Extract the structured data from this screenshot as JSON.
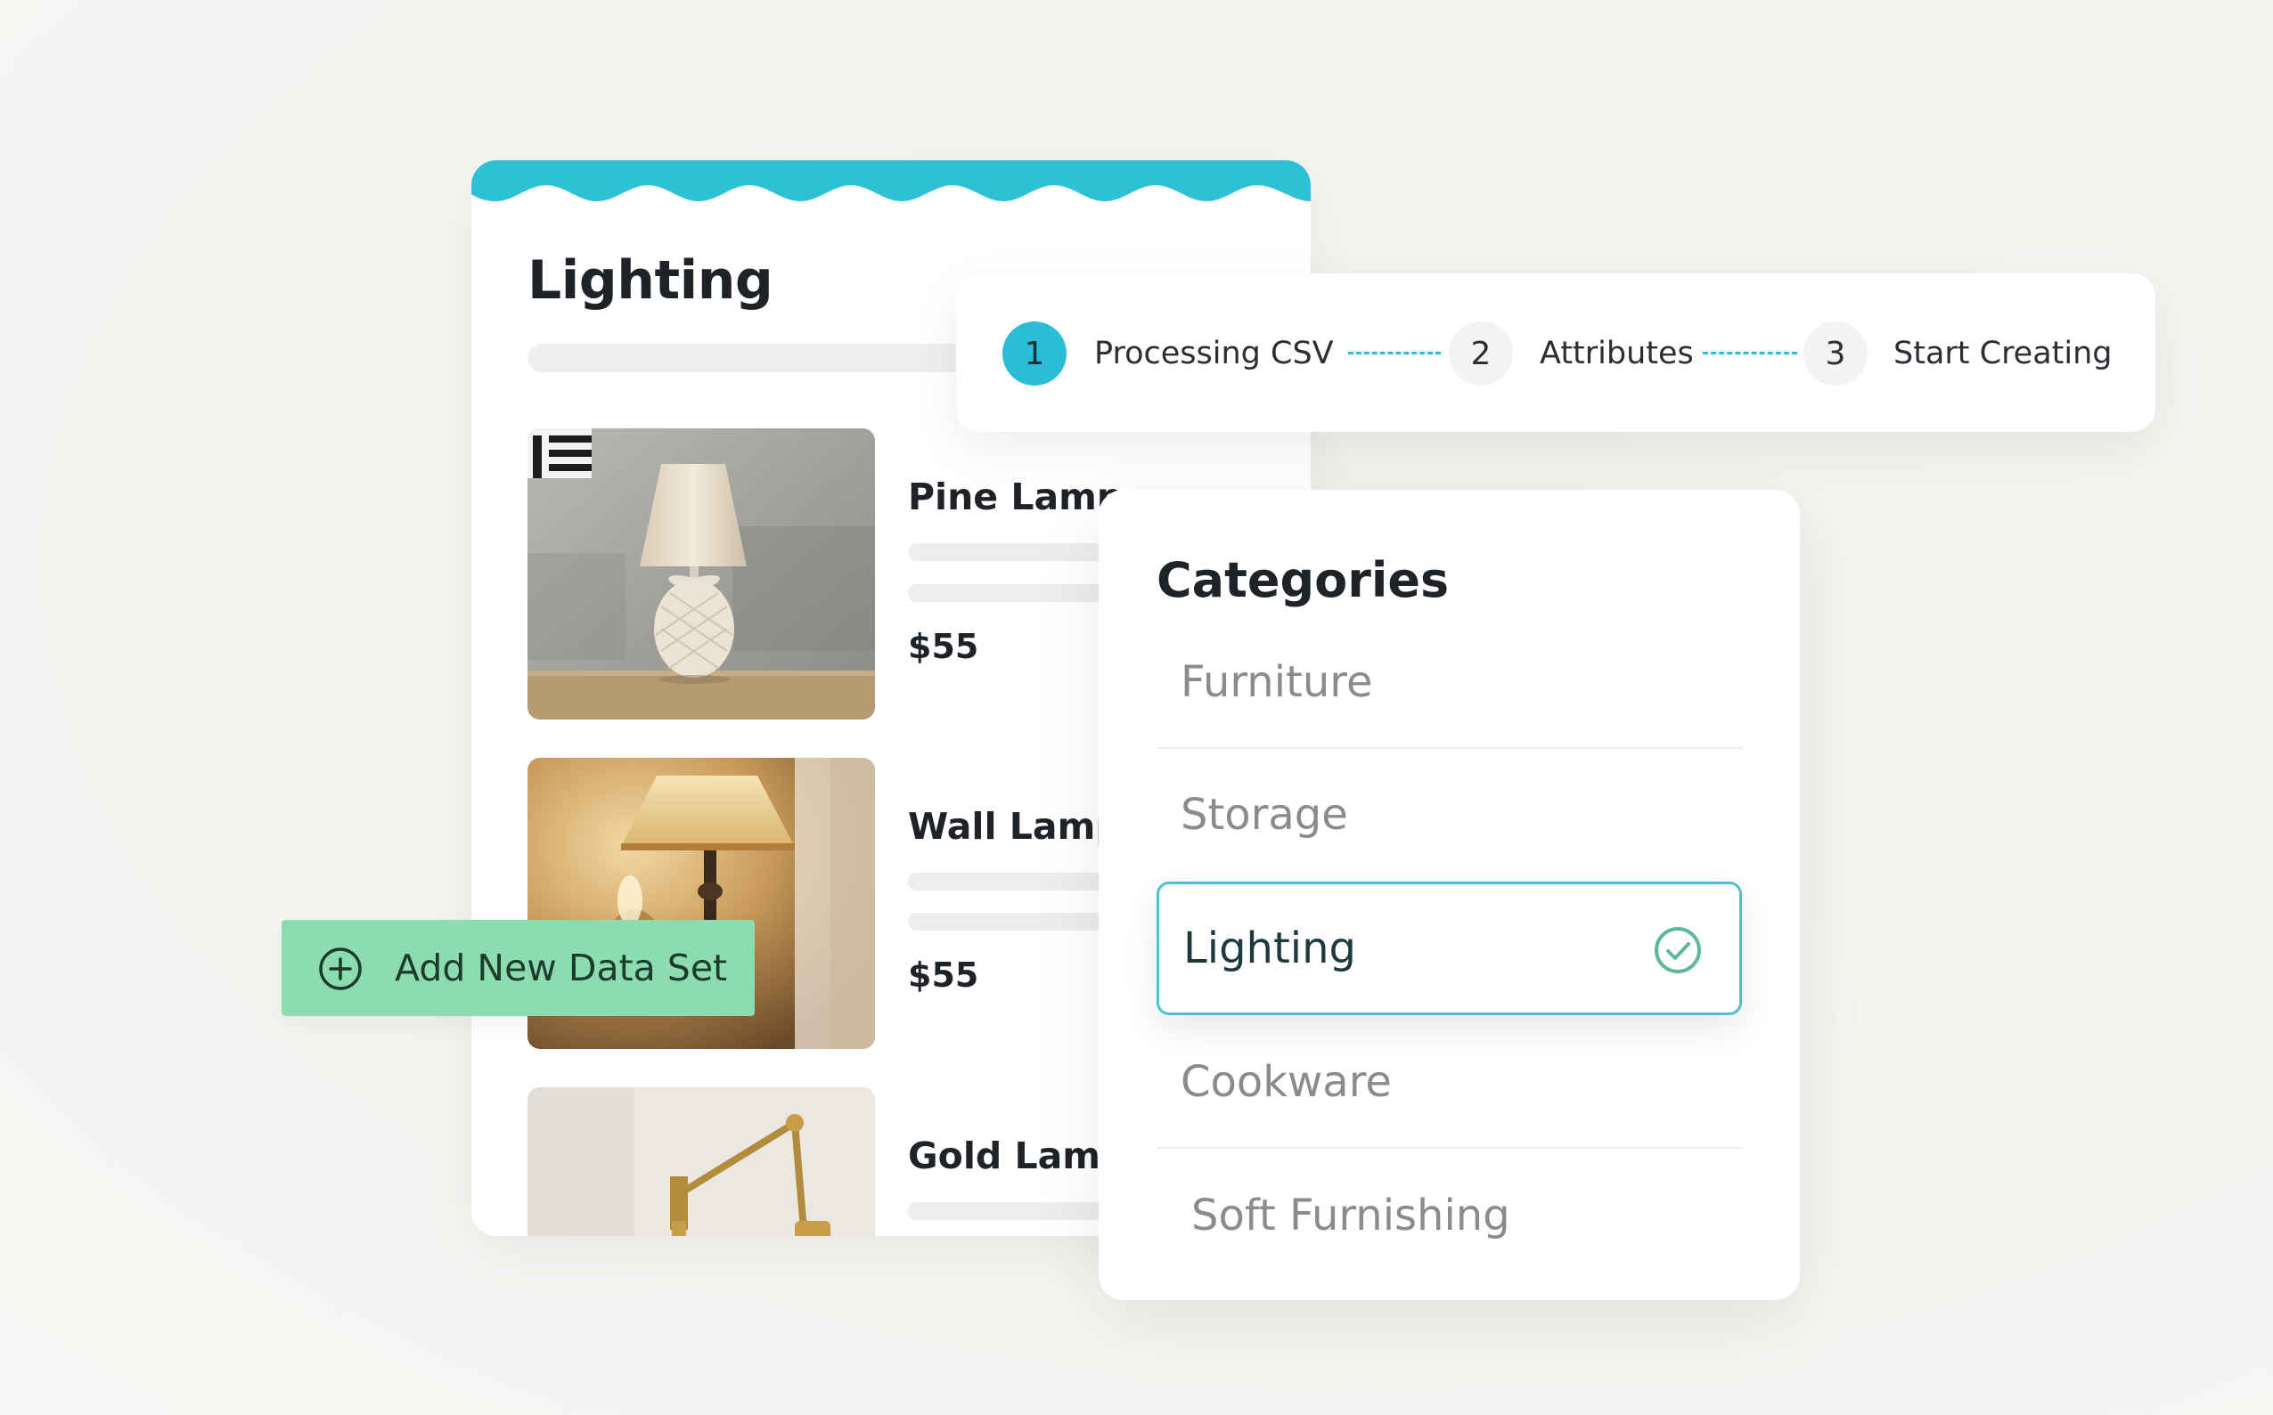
{
  "product_panel": {
    "title": "Lighting",
    "products": [
      {
        "name": "Pine Lamp",
        "price": "$55",
        "image_icon": "table-lamp-photo"
      },
      {
        "name": "Wall Lamp",
        "price": "$55",
        "image_icon": "wall-sconce-photo"
      },
      {
        "name": "Gold Lamp",
        "image_icon": "gold-swing-arm-lamp-photo"
      }
    ],
    "accent_color": "#2bbdd6"
  },
  "stepper": {
    "steps": [
      {
        "number": "1",
        "label": "Processing CSV",
        "state": "active"
      },
      {
        "number": "2",
        "label": "Attributes",
        "state": "pending"
      },
      {
        "number": "3",
        "label": "Start Creating",
        "state": "pending"
      }
    ]
  },
  "categories": {
    "heading": "Categories",
    "items": [
      {
        "label": "Furniture"
      },
      {
        "label": "Storage"
      },
      {
        "label": "Lighting",
        "selected": true
      },
      {
        "label": "Cookware"
      },
      {
        "label": "Soft Furnishing"
      }
    ],
    "selected_border_color": "#4fc0cf"
  },
  "add_dataset_button": {
    "label": "Add New Data Set",
    "icon": "plus-circle-icon",
    "color": "#8ddcb0"
  }
}
